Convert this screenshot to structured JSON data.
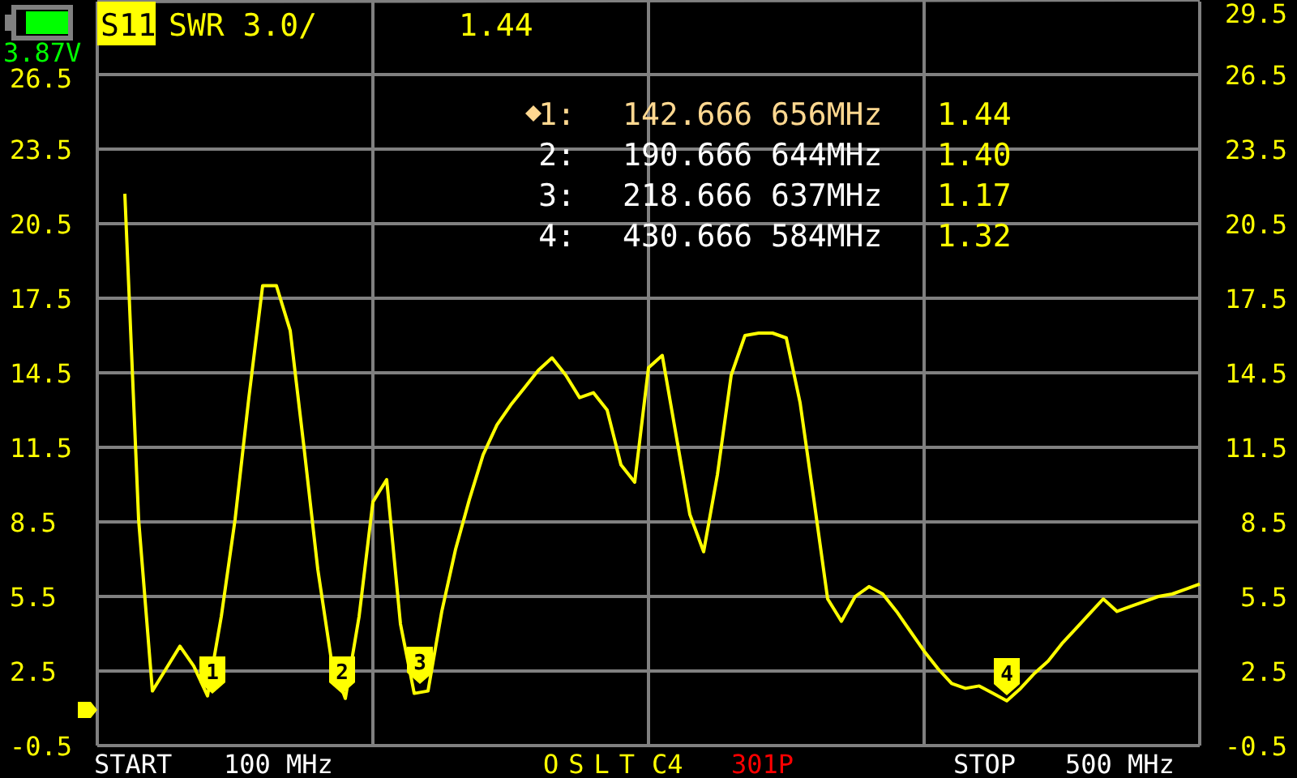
{
  "status": {
    "voltage": "3.87V"
  },
  "trace": {
    "format": "SWR 3.0/",
    "value": "1.44"
  },
  "markers": [
    {
      "label": "1:",
      "selected": true,
      "frequency": "142.666 656MHz",
      "value": "1.44"
    },
    {
      "label": "2:",
      "selected": false,
      "frequency": "190.666 644MHz",
      "value": "1.40"
    },
    {
      "label": "3:",
      "selected": false,
      "frequency": "218.666 637MHz",
      "value": "1.17"
    },
    {
      "label": "4:",
      "selected": false,
      "frequency": "430.666 584MHz",
      "value": "1.32"
    }
  ],
  "chart_data": {
    "type": "line",
    "categories": [
      null,
      null,
      null,
      null,
      null,
      null,
      null,
      null,
      null,
      null,
      null,
      null,
      null,
      null,
      null,
      null,
      null,
      null,
      null,
      null,
      null,
      null,
      null,
      null,
      null,
      null,
      null,
      null,
      null,
      null,
      null,
      null,
      null,
      null,
      null,
      null,
      null,
      null,
      null,
      null,
      null,
      null,
      null,
      null,
      null,
      null,
      null,
      null,
      null,
      null,
      null,
      null,
      null,
      null,
      null,
      null,
      null,
      null,
      null,
      null,
      null,
      null,
      null,
      null,
      null,
      null,
      null,
      null,
      null,
      null,
      null,
      null,
      null,
      null,
      null,
      null,
      null,
      null,
      null,
      null,
      null
    ],
    "series": [
      {
        "name": "S11",
        "color": "#ffff00",
        "values": [
          null,
          null,
          21.7,
          8.6,
          1.7,
          2.6,
          3.5,
          2.7,
          1.5,
          4.7,
          8.6,
          13.5,
          18.0,
          18.0,
          16.2,
          11.5,
          6.6,
          2.9,
          1.4,
          4.7,
          9.3,
          10.2,
          4.4,
          1.6,
          1.7,
          4.9,
          7.4,
          9.4,
          11.2,
          12.4,
          13.2,
          13.9,
          14.6,
          15.1,
          14.4,
          13.5,
          13.7,
          13.0,
          10.8,
          10.1,
          14.7,
          15.2,
          12.0,
          8.8,
          7.3,
          10.4,
          14.4,
          16.0,
          16.1,
          16.1,
          15.9,
          13.3,
          9.4,
          5.4,
          4.5,
          5.5,
          5.9,
          5.6,
          4.9,
          4.1,
          3.3,
          2.6,
          2.0,
          1.8,
          1.9,
          1.6,
          1.3,
          1.8,
          2.4,
          2.9,
          3.6,
          4.2,
          4.8,
          5.4,
          4.9,
          5.1,
          5.3,
          5.5,
          5.6,
          5.8,
          6.0
        ]
      }
    ],
    "ylim": [
      -0.5,
      29.5
    ],
    "yticks": [
      {
        "value": 29.5,
        "label": "29.5"
      },
      {
        "value": 26.5,
        "label": "26.5"
      },
      {
        "value": 23.5,
        "label": "23.5"
      },
      {
        "value": 20.5,
        "label": "20.5"
      },
      {
        "value": 17.5,
        "label": "17.5"
      },
      {
        "value": 14.5,
        "label": "14.5"
      },
      {
        "value": 11.5,
        "label": "11.5"
      },
      {
        "value": 8.5,
        "label": "8.5"
      },
      {
        "value": 5.5,
        "label": "5.5"
      },
      {
        "value": 2.5,
        "label": "2.5"
      },
      {
        "value": -0.5,
        "label": "-0.5"
      }
    ],
    "grid": true,
    "annotations": [
      "1",
      "2",
      "3",
      "4"
    ]
  },
  "sweep": {
    "start_label": "START",
    "start": "100 MHz",
    "calibration": "OSLT",
    "cal_slot": "C4",
    "points": "301P",
    "stop_label": "STOP",
    "stop": "500 MHz"
  }
}
